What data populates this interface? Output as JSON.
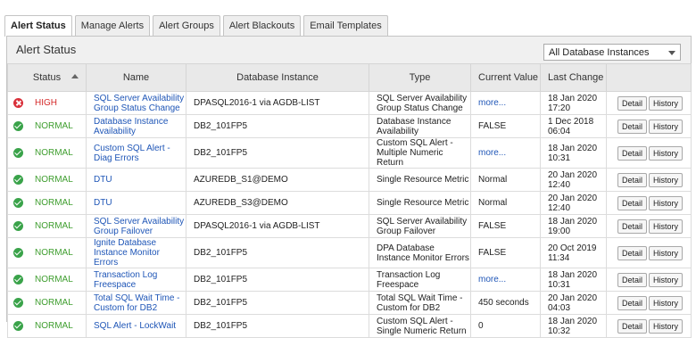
{
  "tabs": [
    {
      "label": "Alert Status",
      "active": true
    },
    {
      "label": "Manage Alerts",
      "active": false
    },
    {
      "label": "Alert Groups",
      "active": false
    },
    {
      "label": "Alert Blackouts",
      "active": false
    },
    {
      "label": "Email Templates",
      "active": false
    }
  ],
  "panel": {
    "title": "Alert Status",
    "filter_selected": "All Database Instances"
  },
  "columns": {
    "status": "Status",
    "name": "Name",
    "instance": "Database Instance",
    "type": "Type",
    "value": "Current Value",
    "last_change": "Last Change"
  },
  "buttons": {
    "detail": "Detail",
    "history": "History"
  },
  "colors": {
    "normal": "#3f9e2f",
    "high": "#d52b2b",
    "link": "#1f56b7"
  },
  "rows": [
    {
      "status": "HIGH",
      "level": "high",
      "name": "SQL Server Availability Group Status Change",
      "instance": "DPASQL2016-1 via AGDB-LIST",
      "type": "SQL Server Availability Group Status Change",
      "value": "more...",
      "value_is_link": true,
      "last_change": "18 Jan 2020 17:20"
    },
    {
      "status": "NORMAL",
      "level": "normal",
      "name": "Database Instance Availability",
      "instance": "DB2_101FP5",
      "type": "Database Instance Availability",
      "value": "FALSE",
      "value_is_link": false,
      "last_change": "1 Dec 2018 06:04"
    },
    {
      "status": "NORMAL",
      "level": "normal",
      "name": "Custom SQL Alert - Diag Errors",
      "instance": "DB2_101FP5",
      "type": "Custom SQL Alert - Multiple Numeric Return",
      "value": "more...",
      "value_is_link": true,
      "last_change": "18 Jan 2020 10:31"
    },
    {
      "status": "NORMAL",
      "level": "normal",
      "name": "DTU",
      "instance": "AZUREDB_S1@DEMO",
      "type": "Single Resource Metric",
      "value": "Normal",
      "value_is_link": false,
      "last_change": "20 Jan 2020 12:40"
    },
    {
      "status": "NORMAL",
      "level": "normal",
      "name": "DTU",
      "instance": "AZUREDB_S3@DEMO",
      "type": "Single Resource Metric",
      "value": "Normal",
      "value_is_link": false,
      "last_change": "20 Jan 2020 12:40"
    },
    {
      "status": "NORMAL",
      "level": "normal",
      "name": "SQL Server Availability Group Failover",
      "instance": "DPASQL2016-1 via AGDB-LIST",
      "type": "SQL Server Availability Group Failover",
      "value": "FALSE",
      "value_is_link": false,
      "last_change": "18 Jan 2020 19:00"
    },
    {
      "status": "NORMAL",
      "level": "normal",
      "name": "Ignite Database Instance Monitor Errors",
      "instance": "DB2_101FP5",
      "type": "DPA Database Instance Monitor Errors",
      "value": "FALSE",
      "value_is_link": false,
      "last_change": "20 Oct 2019 11:34"
    },
    {
      "status": "NORMAL",
      "level": "normal",
      "name": "Transaction Log Freespace",
      "instance": "DB2_101FP5",
      "type": "Transaction Log Freespace",
      "value": "more...",
      "value_is_link": true,
      "last_change": "18 Jan 2020 10:31"
    },
    {
      "status": "NORMAL",
      "level": "normal",
      "name": "Total SQL Wait Time - Custom for DB2",
      "instance": "DB2_101FP5",
      "type": "Total SQL Wait Time - Custom for DB2",
      "value": "450 seconds",
      "value_is_link": false,
      "last_change": "20 Jan 2020 04:03"
    },
    {
      "status": "NORMAL",
      "level": "normal",
      "name": "SQL Alert - LockWait",
      "instance": "DB2_101FP5",
      "type": "Custom SQL Alert - Single Numeric Return",
      "value": "0",
      "value_is_link": false,
      "last_change": "18 Jan 2020 10:32"
    }
  ]
}
